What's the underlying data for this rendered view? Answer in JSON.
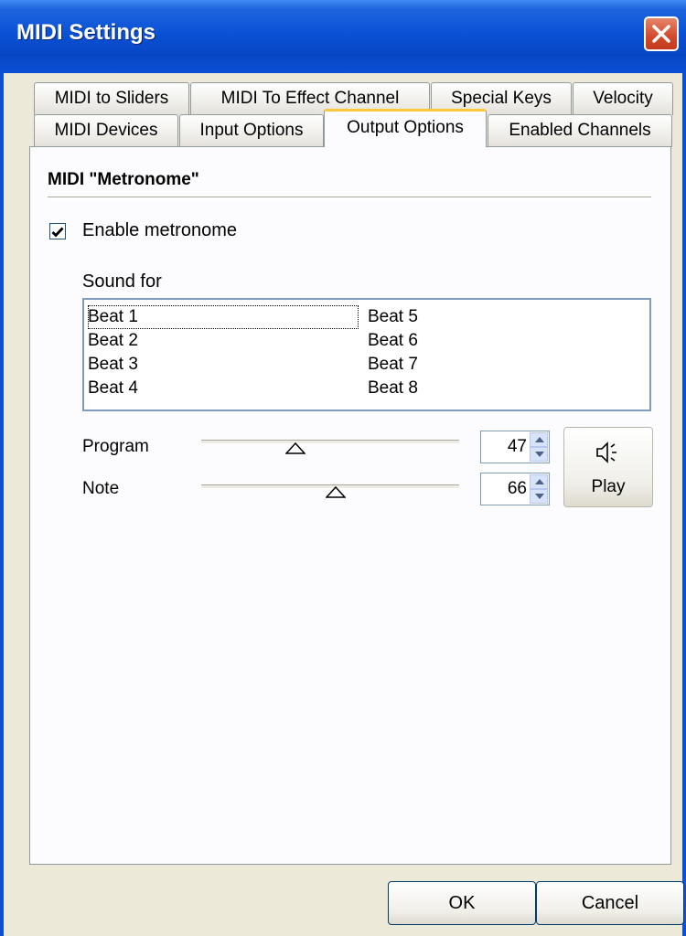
{
  "window": {
    "title": "MIDI Settings"
  },
  "tabs_row1": [
    "MIDI to Sliders",
    "MIDI To Effect Channel",
    "Special Keys",
    "Velocity"
  ],
  "tabs_row2": [
    "MIDI Devices",
    "Input Options",
    "Output Options",
    "Enabled Channels"
  ],
  "active_tab": "Output Options",
  "metronome": {
    "group_title": "MIDI \"Metronome\"",
    "enable_label": "Enable metronome",
    "enabled": true,
    "sound_for_label": "Sound for",
    "beats": [
      "Beat 1",
      "Beat 2",
      "Beat 3",
      "Beat 4",
      "Beat 5",
      "Beat 6",
      "Beat 7",
      "Beat 8"
    ],
    "selected_beat": "Beat 1",
    "program_label": "Program",
    "program_value": "47",
    "note_label": "Note",
    "note_value": "66",
    "play_label": "Play"
  },
  "footer": {
    "ok_label": "OK",
    "cancel_label": "Cancel"
  },
  "colors": {
    "titlebar": "#0a52d6",
    "face": "#ece9d8",
    "tab_highlight": "#ffc83c"
  },
  "icons": {
    "close": "close-icon",
    "speaker": "speaker-icon",
    "check": "checkmark-icon"
  }
}
